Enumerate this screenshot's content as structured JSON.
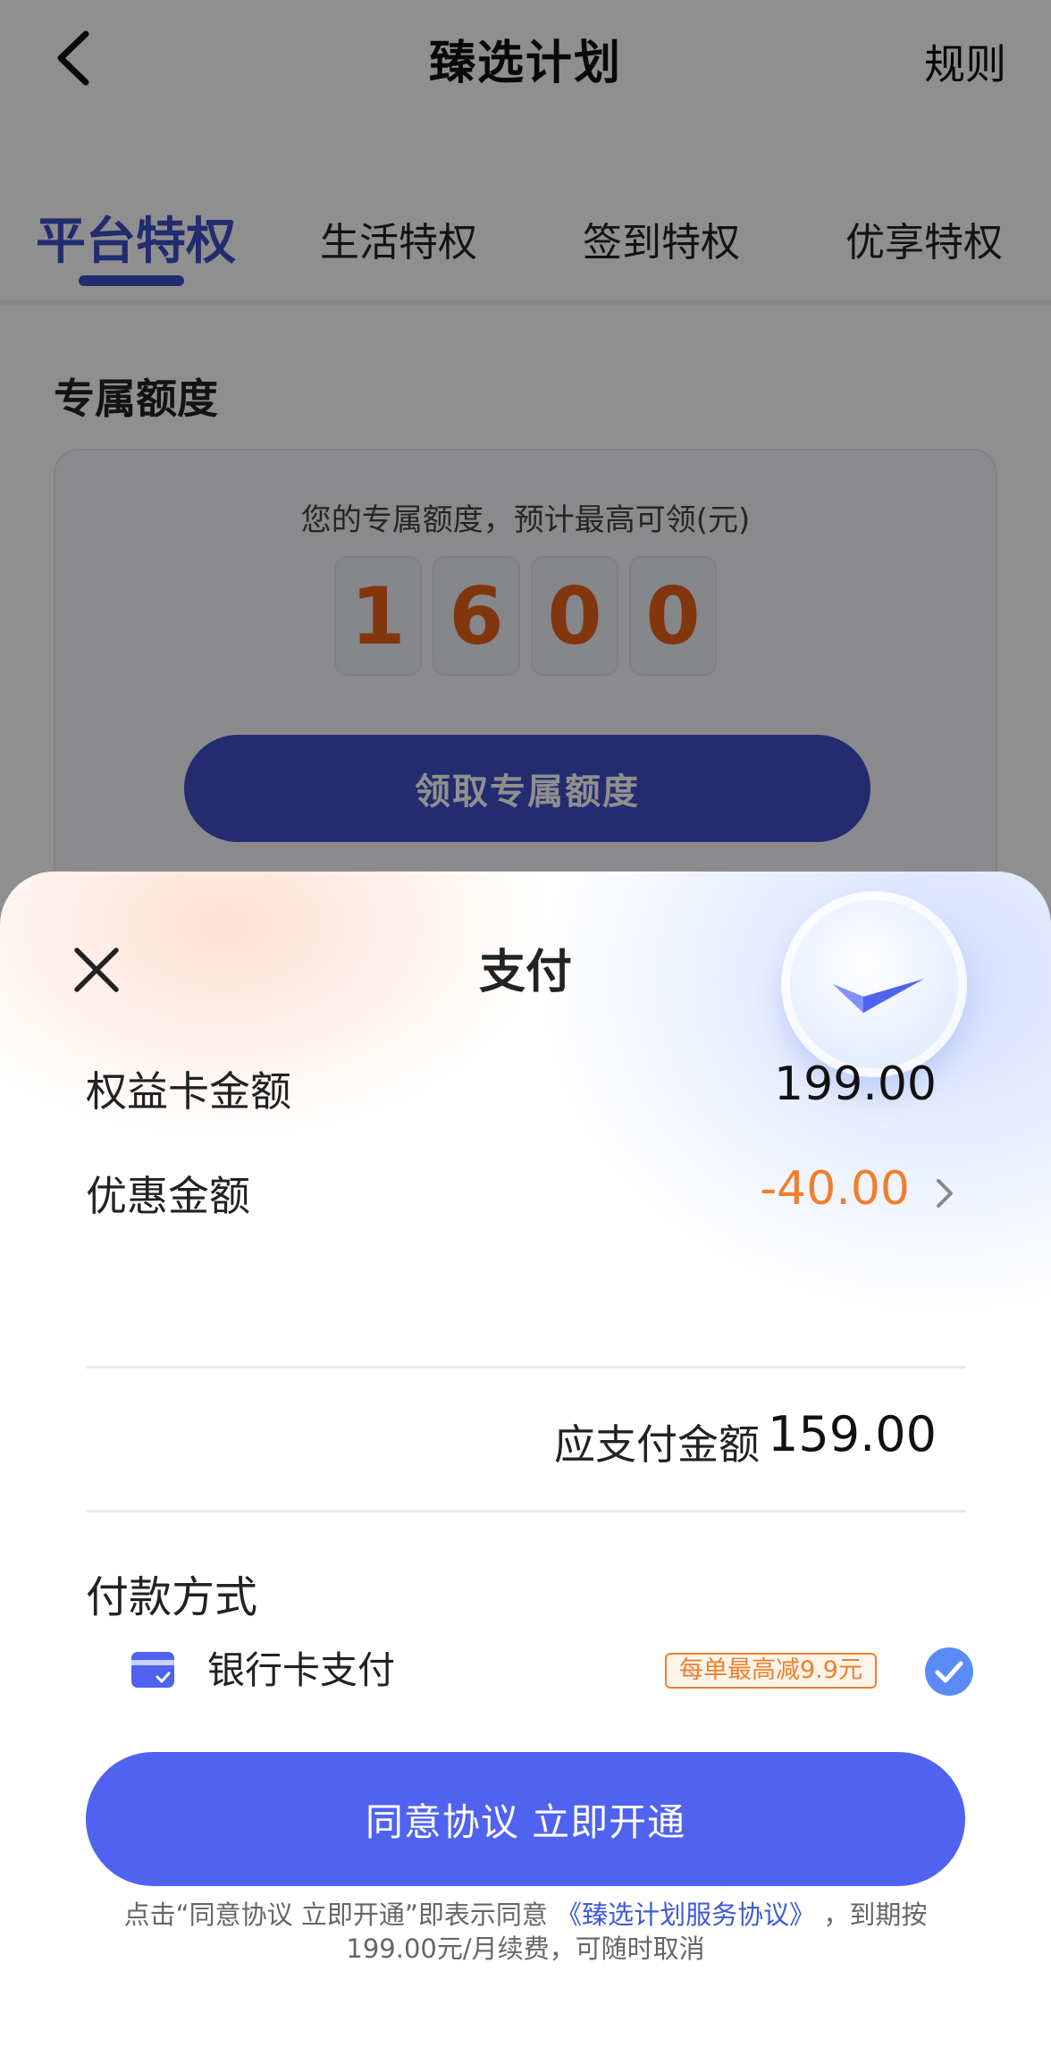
{
  "nav": {
    "title": "臻选计划",
    "back_icon": "chevron-left-icon",
    "rules": "规则"
  },
  "tabs": [
    {
      "label": "平台特权",
      "active": true
    },
    {
      "label": "生活特权",
      "active": false
    },
    {
      "label": "签到特权",
      "active": false
    },
    {
      "label": "优享特权",
      "active": false
    }
  ],
  "quota": {
    "section_title": "专属额度",
    "caption": "您的专属额度，预计最高可领(元)",
    "digits": [
      "1",
      "6",
      "0",
      "0"
    ],
    "claim_button": "领取专属额度"
  },
  "sheet": {
    "title": "支付",
    "close_icon": "close-icon",
    "card_amount_label": "权益卡金额",
    "card_amount_value": "199.00",
    "discount_label": "优惠金额",
    "discount_value": "-40.00",
    "total_label": "应支付金额",
    "total_value": "159.00",
    "payment_title": "付款方式",
    "payment_method": "银行卡支付",
    "payment_promo": "每单最高减9.9元",
    "payment_selected": true,
    "cta": "同意协议 立即开通",
    "agreement_prefix": "点击“同意协议 立即开通”即表示同意",
    "agreement_link": "《臻选计划服务协议》",
    "agreement_suffix": "，到期按199.00元/月续费，可随时取消"
  },
  "colors": {
    "brand": "#3d4fc7",
    "cta": "#4f62f0",
    "accent_orange": "#ee7f2c",
    "digit_orange": "#e8611a"
  }
}
